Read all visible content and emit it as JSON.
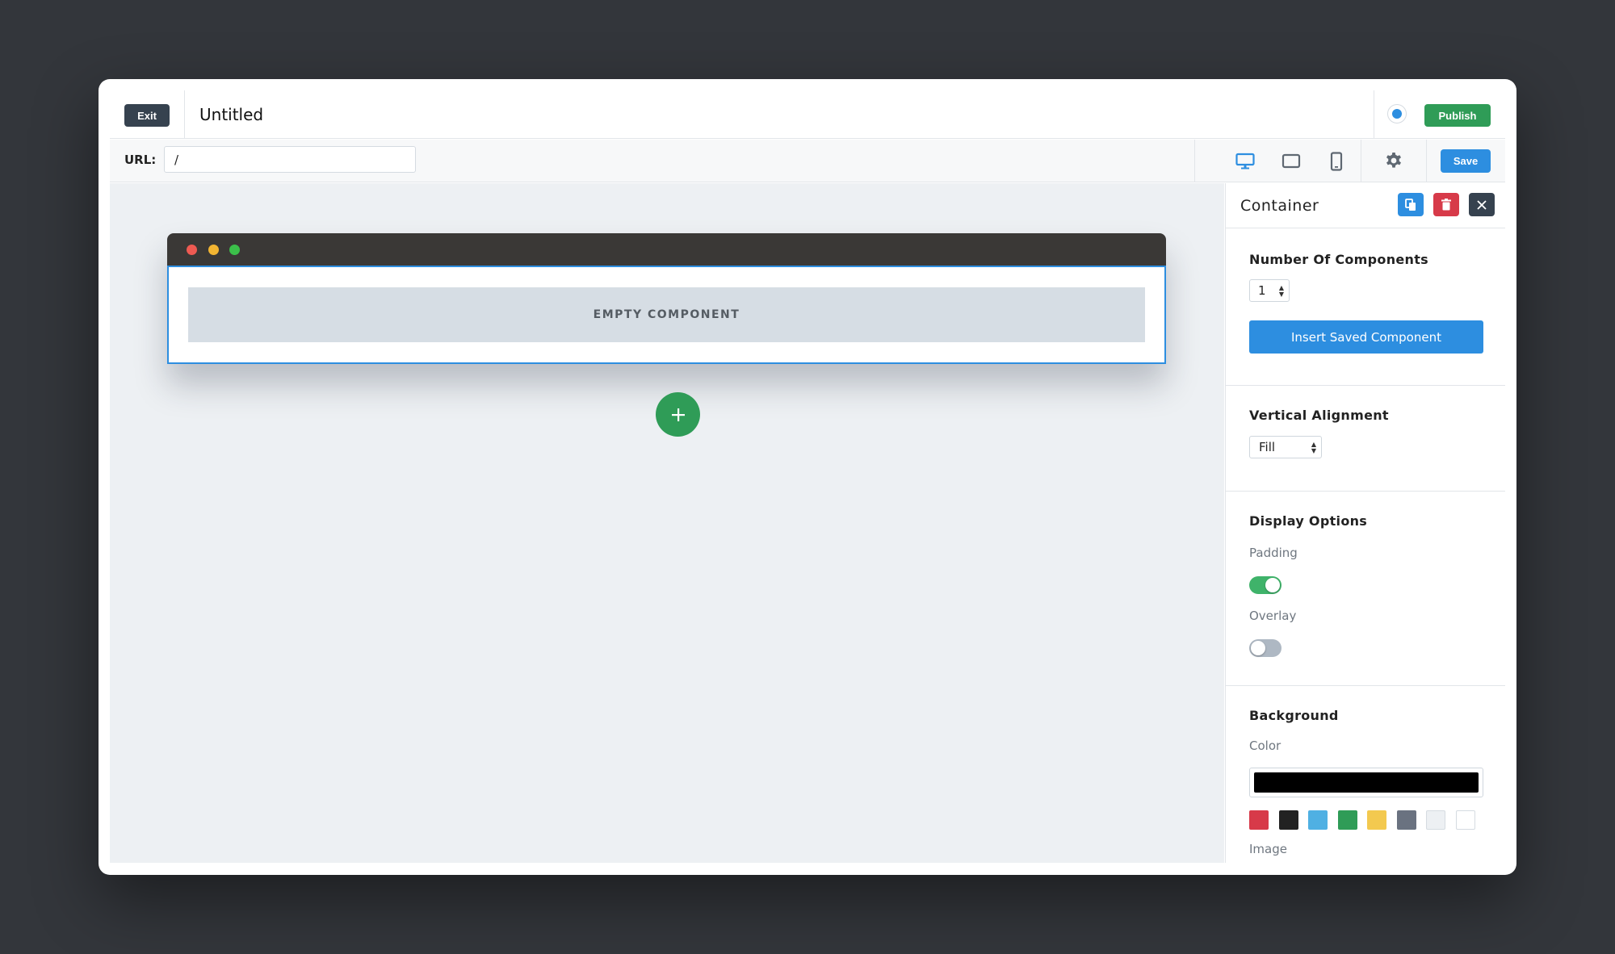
{
  "topbar": {
    "exit_label": "Exit",
    "page_title": "Untitled",
    "publish_label": "Publish"
  },
  "urlbar": {
    "url_label": "URL:",
    "url_value": "/",
    "save_label": "Save",
    "device_icons": [
      "desktop-icon",
      "tablet-icon",
      "mobile-icon"
    ],
    "settings_icon": "gear-icon"
  },
  "canvas": {
    "empty_component_label": "EMPTY COMPONENT"
  },
  "panel": {
    "title": "Container",
    "header_icons": [
      "copy-icon",
      "trash-icon",
      "close-icon"
    ],
    "number_of_components": {
      "title": "Number Of Components",
      "value": "1",
      "insert_label": "Insert Saved Component"
    },
    "vertical_alignment": {
      "title": "Vertical Alignment",
      "value": "Fill"
    },
    "display_options": {
      "title": "Display Options",
      "padding_label": "Padding",
      "padding_on": true,
      "overlay_label": "Overlay",
      "overlay_on": false
    },
    "background": {
      "title": "Background",
      "color_label": "Color",
      "color_value": "#000000",
      "swatches": [
        "#d73a49",
        "#222222",
        "#4fb0e3",
        "#2f9c57",
        "#f3c94f",
        "#6a7280",
        "#edf0f3",
        "#ffffff"
      ],
      "image_label": "Image"
    }
  },
  "colors": {
    "accent": "#2d8ee0",
    "success": "#2f9c57",
    "danger": "#d73a49",
    "dark": "#36424f"
  }
}
